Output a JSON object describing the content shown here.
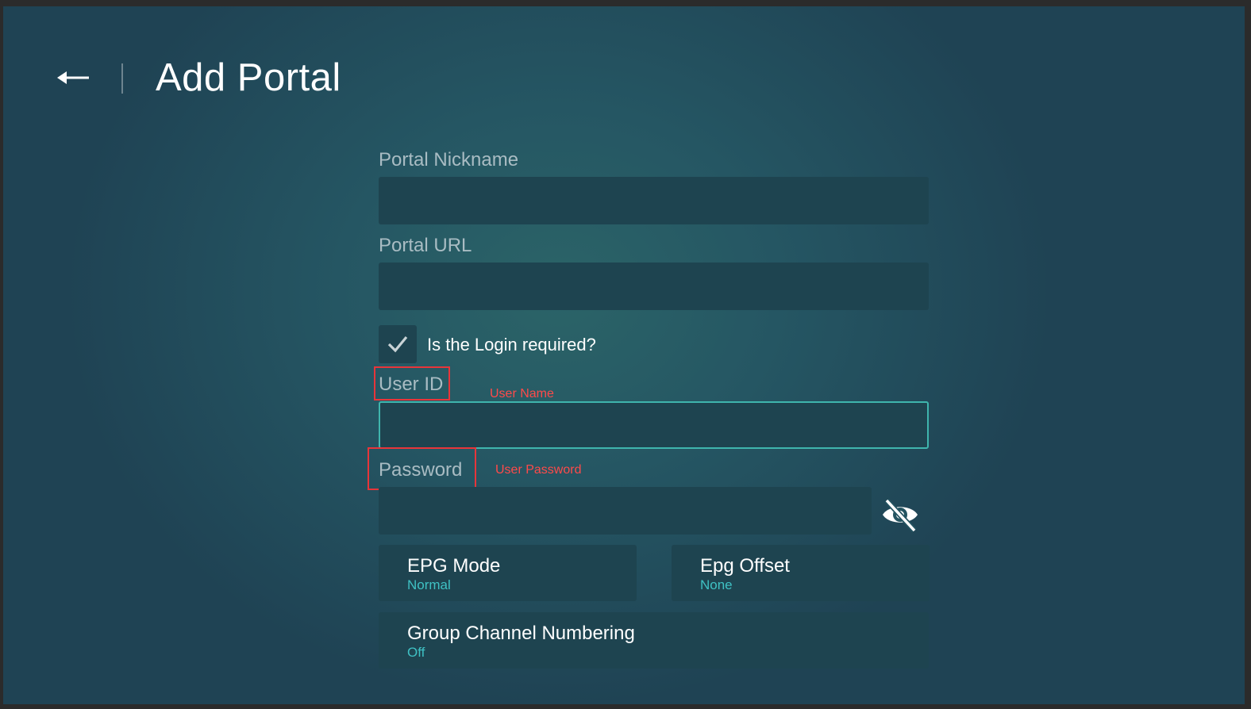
{
  "header": {
    "title": "Add Portal",
    "back_icon": "arrow-left-icon"
  },
  "form": {
    "nickname": {
      "label": "Portal Nickname",
      "value": ""
    },
    "url": {
      "label": "Portal URL",
      "value": ""
    },
    "login_required": {
      "label": "Is the Login required?",
      "checked": true,
      "icon": "checkmark-icon"
    },
    "user_id": {
      "label": "User ID",
      "value": "",
      "focused": true
    },
    "password": {
      "label": "Password",
      "value": "",
      "toggle_icon": "eye-slash-icon"
    }
  },
  "annotations": {
    "user_id_note": "User Name",
    "password_note": "User Password",
    "color": "#e8353a"
  },
  "options": {
    "epg_mode": {
      "title": "EPG Mode",
      "value": "Normal"
    },
    "epg_offset": {
      "title": "Epg Offset",
      "value": "None"
    },
    "group_channel_numbering": {
      "title": "Group Channel Numbering",
      "value": "Off"
    }
  },
  "colors": {
    "accent": "#3fc1c4",
    "field_background": "#1e4450",
    "focus_border": "#3fb5ad",
    "background": "#255663"
  }
}
